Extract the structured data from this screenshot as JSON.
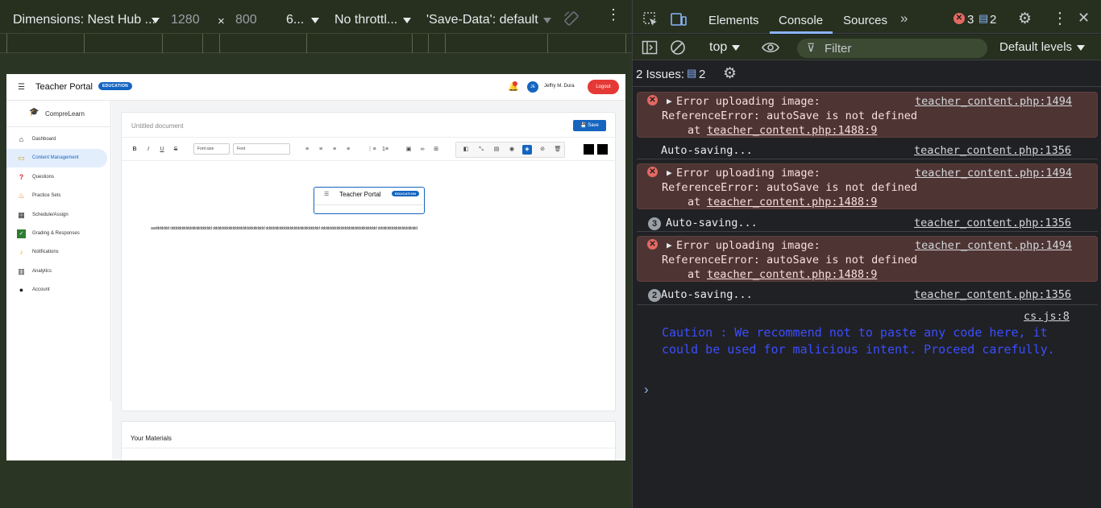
{
  "device_toolbar": {
    "device": "Dimensions: Nest Hub ...",
    "width": "1280",
    "times": "×",
    "height": "800",
    "zoom": "6...",
    "throttle": "No throttl...",
    "save_data": "'Save-Data': default"
  },
  "page": {
    "portal_title": "Teacher Portal",
    "badge": "EDUCATION",
    "user_initials": "JE",
    "user_name": "Jeffry M. Dura",
    "logout": "Logout",
    "brand": "CompreLearn",
    "nav": [
      {
        "label": "Dashboard",
        "icon": "home-icon"
      },
      {
        "label": "Content Management",
        "icon": "folder-icon"
      },
      {
        "label": "Questions",
        "icon": "question-icon"
      },
      {
        "label": "Practice Sets",
        "icon": "flame-icon"
      },
      {
        "label": "Schedule/Assign",
        "icon": "calendar-icon"
      },
      {
        "label": "Grading & Responses",
        "icon": "check-icon"
      },
      {
        "label": "Notifications",
        "icon": "bell-icon"
      },
      {
        "label": "Analytics",
        "icon": "chart-icon"
      },
      {
        "label": "Account",
        "icon": "user-icon"
      }
    ],
    "active_nav_index": 1,
    "doc_placeholder": "Untitled document",
    "save_label": "Save",
    "font_size_select": "Font size",
    "font_select": "Font",
    "mini_title": "Teacher Portal",
    "mini_badge": "EDUCATION",
    "doc_text": "asddddddd dddddddddddddddddddd ddddddddddddddddddddddddd dddddddddddddddddddddddddd ddddddddddddddddddddddddddd ddddddddddddddddddd",
    "materials_title": "Your Materials",
    "colors": {
      "primary": "#1565c0",
      "danger": "#e53935"
    }
  },
  "devtools": {
    "tabs": [
      "Elements",
      "Console",
      "Sources"
    ],
    "active_tab": "Console",
    "error_count": "3",
    "message_count": "2",
    "context": "top",
    "filter_placeholder": "Filter",
    "levels": "Default levels",
    "issues_label": "2 Issues:",
    "issues_count": "2",
    "messages": [
      {
        "type": "error",
        "line1": "Error uploading image:",
        "line2": "ReferenceError: autoSave is not defined",
        "line3": "at",
        "link3": "teacher_content.php:1488:9",
        "src": "teacher_content.php:1494"
      },
      {
        "type": "log",
        "count": "",
        "text": "Auto-saving...",
        "src": "teacher_content.php:1356"
      },
      {
        "type": "error",
        "line1": "Error uploading image:",
        "line2": "ReferenceError: autoSave is not defined",
        "line3": "at",
        "link3": "teacher_content.php:1488:9",
        "src": "teacher_content.php:1494"
      },
      {
        "type": "log",
        "count": "3",
        "text": "Auto-saving...",
        "src": "teacher_content.php:1356"
      },
      {
        "type": "error",
        "line1": "Error uploading image:",
        "line2": "ReferenceError: autoSave is not defined",
        "line3": "at",
        "link3": "teacher_content.php:1488:9",
        "src": "teacher_content.php:1494"
      },
      {
        "type": "log",
        "count": "2",
        "text": "Auto-saving...",
        "src": "teacher_content.php:1356"
      }
    ],
    "caution_src": "cs.js:8",
    "caution": " Caution : We recommend not to paste any code here, it could be used for malicious intent. Proceed carefully.",
    "prompt": "›"
  }
}
